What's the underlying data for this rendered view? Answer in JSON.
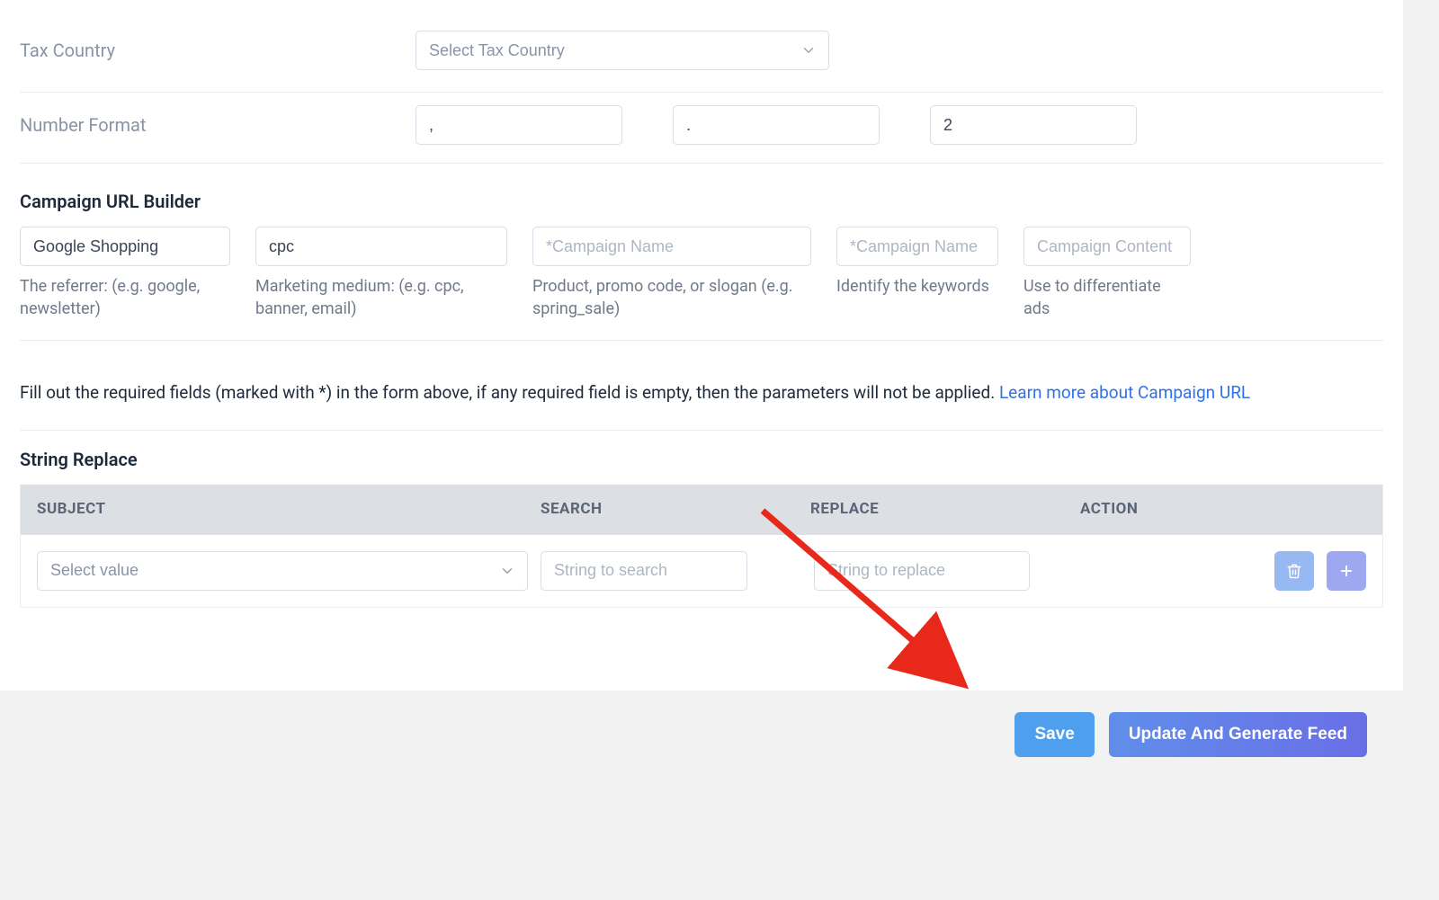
{
  "form": {
    "tax_country_label": "Tax Country",
    "tax_country_placeholder": "Select Tax Country",
    "number_format_label": "Number Format",
    "nf_field1": ",",
    "nf_field2": ".",
    "nf_field3": "2"
  },
  "urlb": {
    "title": "Campaign URL Builder",
    "cols": [
      {
        "value": "Google Shopping",
        "placeholder": "",
        "help": "The referrer: (e.g. google, newsletter)"
      },
      {
        "value": "cpc",
        "placeholder": "",
        "help": "Marketing medium: (e.g. cpc, banner, email)"
      },
      {
        "value": "",
        "placeholder": "*Campaign Name",
        "help": "Product, promo code, or slogan (e.g. spring_sale)"
      },
      {
        "value": "",
        "placeholder": "*Campaign Name",
        "help": "Identify the keywords"
      },
      {
        "value": "",
        "placeholder": "Campaign Content",
        "help": "Use to differentiate ads"
      }
    ]
  },
  "note": {
    "text": "Fill out the required fields (marked with *) in the form above, if any required field is empty, then the parameters will not be applied.",
    "link_text": "Learn more about Campaign URL"
  },
  "replace": {
    "title": "String Replace",
    "head_subject": "SUBJECT",
    "head_search": "SEARCH",
    "head_replace": "REPLACE",
    "head_action": "ACTION",
    "subject_placeholder": "Select value",
    "search_placeholder": "String to search",
    "replace_placeholder": "String to replace"
  },
  "buttons": {
    "save": "Save",
    "generate": "Update And Generate Feed"
  }
}
